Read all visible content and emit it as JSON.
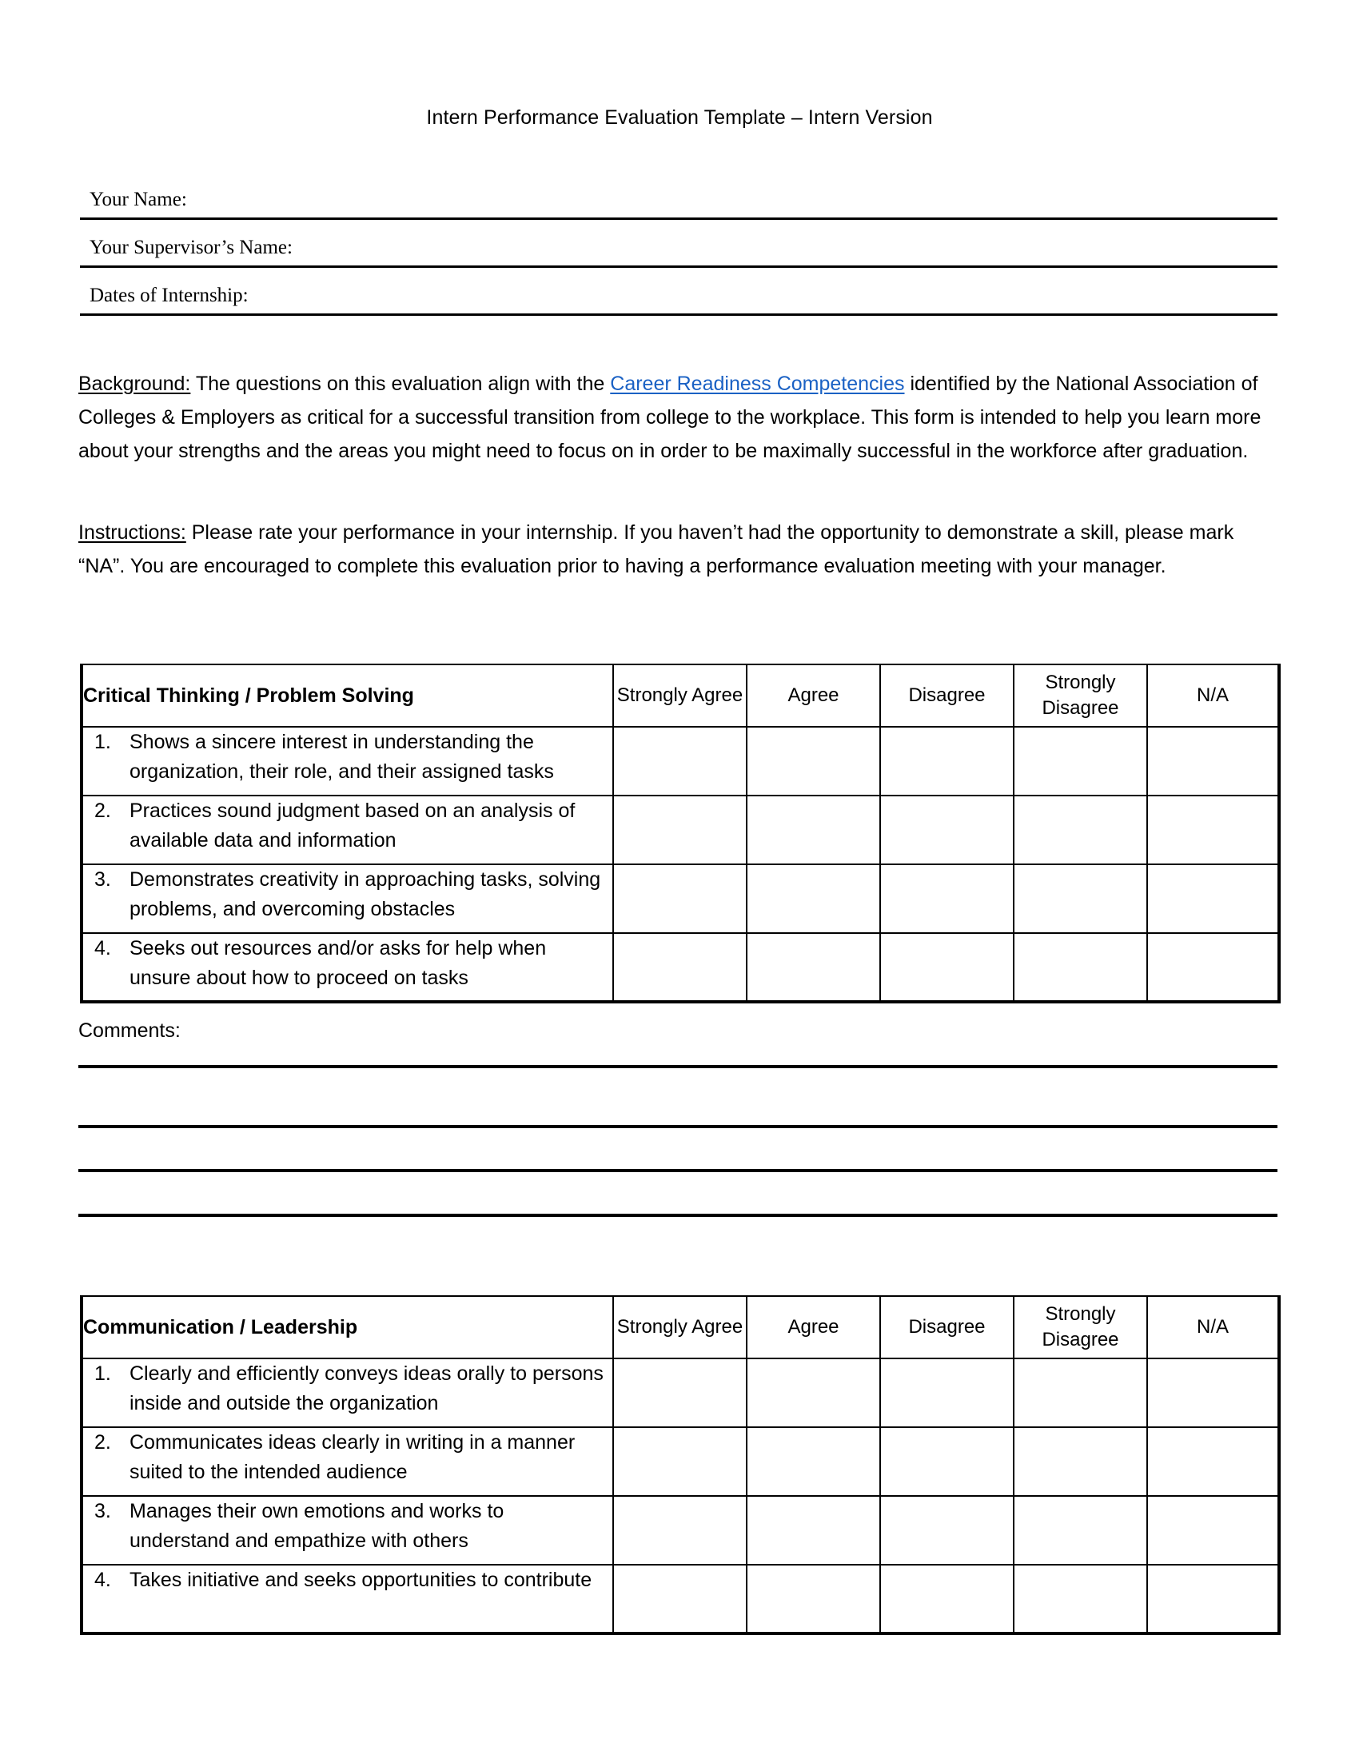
{
  "document": {
    "title": "Intern Performance Evaluation Template – Intern Version"
  },
  "fields": [
    {
      "label": "Your Name:"
    },
    {
      "label": "Your Supervisor’s Name:"
    },
    {
      "label": "Dates of Internship:"
    }
  ],
  "background": {
    "lead": "Background:",
    "text_before_link": " The questions on this evaluation align with the ",
    "link_text": "Career Readiness Competencies",
    "text_after_link": " identified by the National Association of Colleges & Employers as critical for a successful transition from college to the workplace.  This form is intended to help you learn more about your strengths and the areas you might need to focus on in order to be maximally successful in the workforce after graduation."
  },
  "instructions": {
    "lead": "Instructions:",
    "text": " Please rate your performance in your internship.  If you haven’t had the opportunity to demonstrate a skill, please mark “NA”.  You are encouraged to complete this evaluation prior to having a performance evaluation meeting with your manager."
  },
  "scale_headers": [
    "Strongly Agree",
    "Agree",
    "Disagree",
    "Strongly Disagree",
    "N/A"
  ],
  "tables": [
    {
      "category": "Critical Thinking / Problem Solving",
      "items": [
        {
          "number": "1.",
          "text": "Shows a sincere interest in understanding the organization, their role, and their assigned tasks"
        },
        {
          "number": "2.",
          "text": "Practices sound judgment based on an analysis of available data and information"
        },
        {
          "number": "3.",
          "text": "Demonstrates creativity in approaching tasks, solving problems, and overcoming obstacles"
        },
        {
          "number": "4.",
          "text": "Seeks out resources and/or asks for help when unsure about how to proceed on tasks"
        }
      ]
    },
    {
      "category": "Communication / Leadership",
      "items": [
        {
          "number": "1.",
          "text": "Clearly and efficiently conveys ideas orally to persons inside and outside the organization"
        },
        {
          "number": "2.",
          "text": "Communicates ideas clearly in writing in a manner suited to the intended audience"
        },
        {
          "number": "3.",
          "text": "Manages their own emotions and works to understand and empathize with others"
        },
        {
          "number": "4.",
          "text": "Takes initiative and seeks opportunities to contribute"
        }
      ]
    }
  ],
  "comments": {
    "label": "Comments:",
    "line_count": 4
  },
  "colors": {
    "text": "#000000",
    "link": "#1a61c4",
    "rule": "#000000",
    "page_background": "#ffffff"
  }
}
